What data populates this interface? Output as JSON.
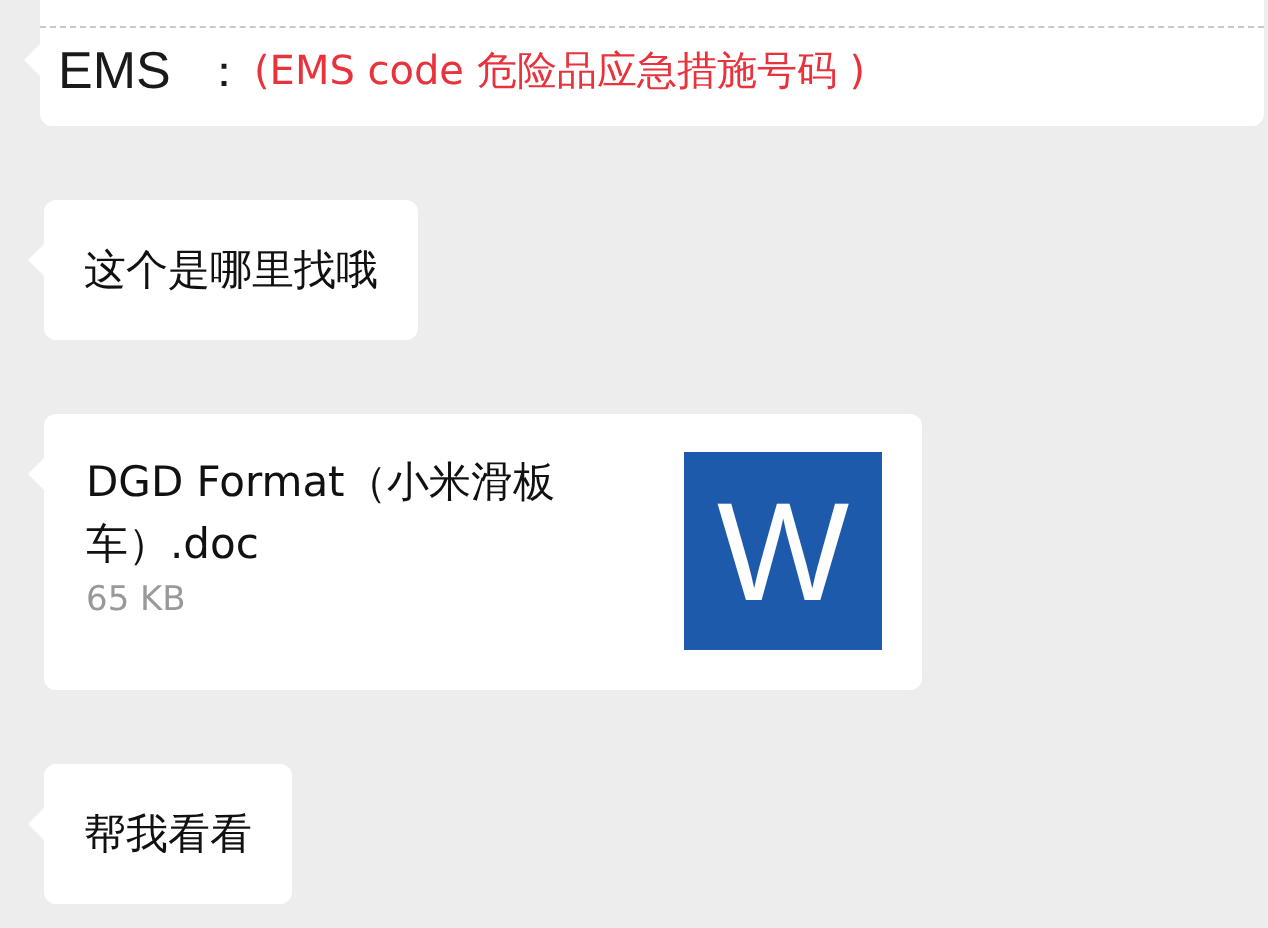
{
  "messages": [
    {
      "kind": "document",
      "label": "EMS",
      "separator": "：",
      "note": "(EMS code 危险品应急措施号码 )"
    },
    {
      "kind": "text",
      "text": "这个是哪里找哦"
    },
    {
      "kind": "file",
      "name": "DGD Format（小米滑板车）.doc",
      "size": "65 KB",
      "icon_letter": "W"
    },
    {
      "kind": "text",
      "text": "帮我看看"
    }
  ]
}
